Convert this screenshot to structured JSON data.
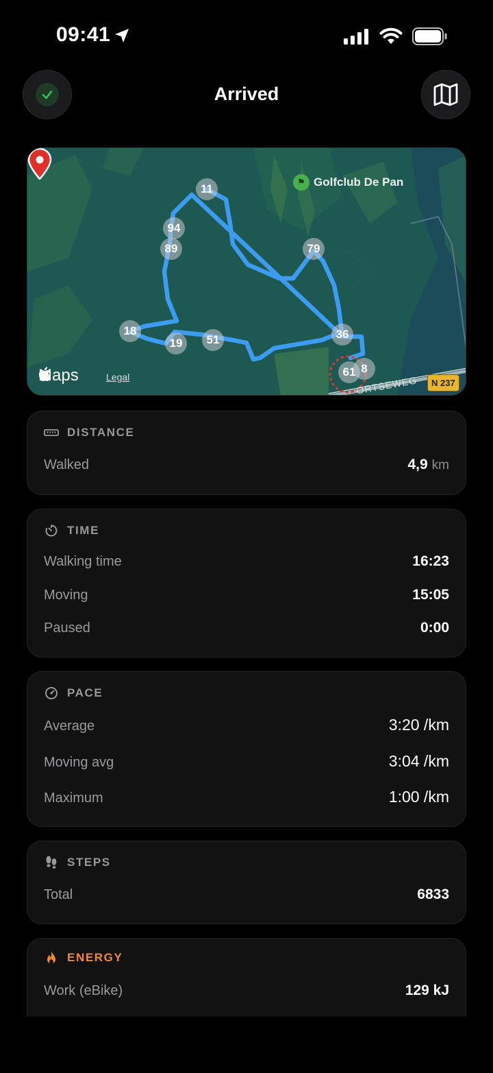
{
  "status_bar": {
    "time": "09:41"
  },
  "nav": {
    "title": "Arrived"
  },
  "map": {
    "poi": "Golfclub De Pan",
    "brand": "Maps",
    "legal": "Legal",
    "road_badge": "N 237",
    "road_name": "ORTSEWEG",
    "markers": [
      "11",
      "94",
      "89",
      "79",
      "18",
      "19",
      "51",
      "36",
      "61",
      "8"
    ]
  },
  "distance": {
    "header": "DISTANCE",
    "rows": [
      {
        "label": "Walked",
        "value": "4,9",
        "unit": "km"
      }
    ]
  },
  "time": {
    "header": "TIME",
    "rows": [
      {
        "label": "Walking time",
        "value": "16:23"
      },
      {
        "label": "Moving",
        "value": "15:05"
      },
      {
        "label": "Paused",
        "value": "0:00"
      }
    ]
  },
  "pace": {
    "header": "PACE",
    "rows": [
      {
        "label": "Average",
        "value": "3:20 /km"
      },
      {
        "label": "Moving avg",
        "value": "3:04 /km"
      },
      {
        "label": "Maximum",
        "value": "1:00 /km"
      }
    ]
  },
  "steps": {
    "header": "STEPS",
    "rows": [
      {
        "label": "Total",
        "value": "6833"
      }
    ]
  },
  "energy": {
    "header": "ENERGY",
    "rows": [
      {
        "label": "Work (eBike)",
        "value": "129 kJ"
      }
    ]
  },
  "colors": {
    "background": "#000000",
    "card": "#121212",
    "route": "#3d9cf0",
    "energy_accent": "#f08a2c",
    "check_green": "#34c759",
    "pin_red": "#e0302a"
  }
}
